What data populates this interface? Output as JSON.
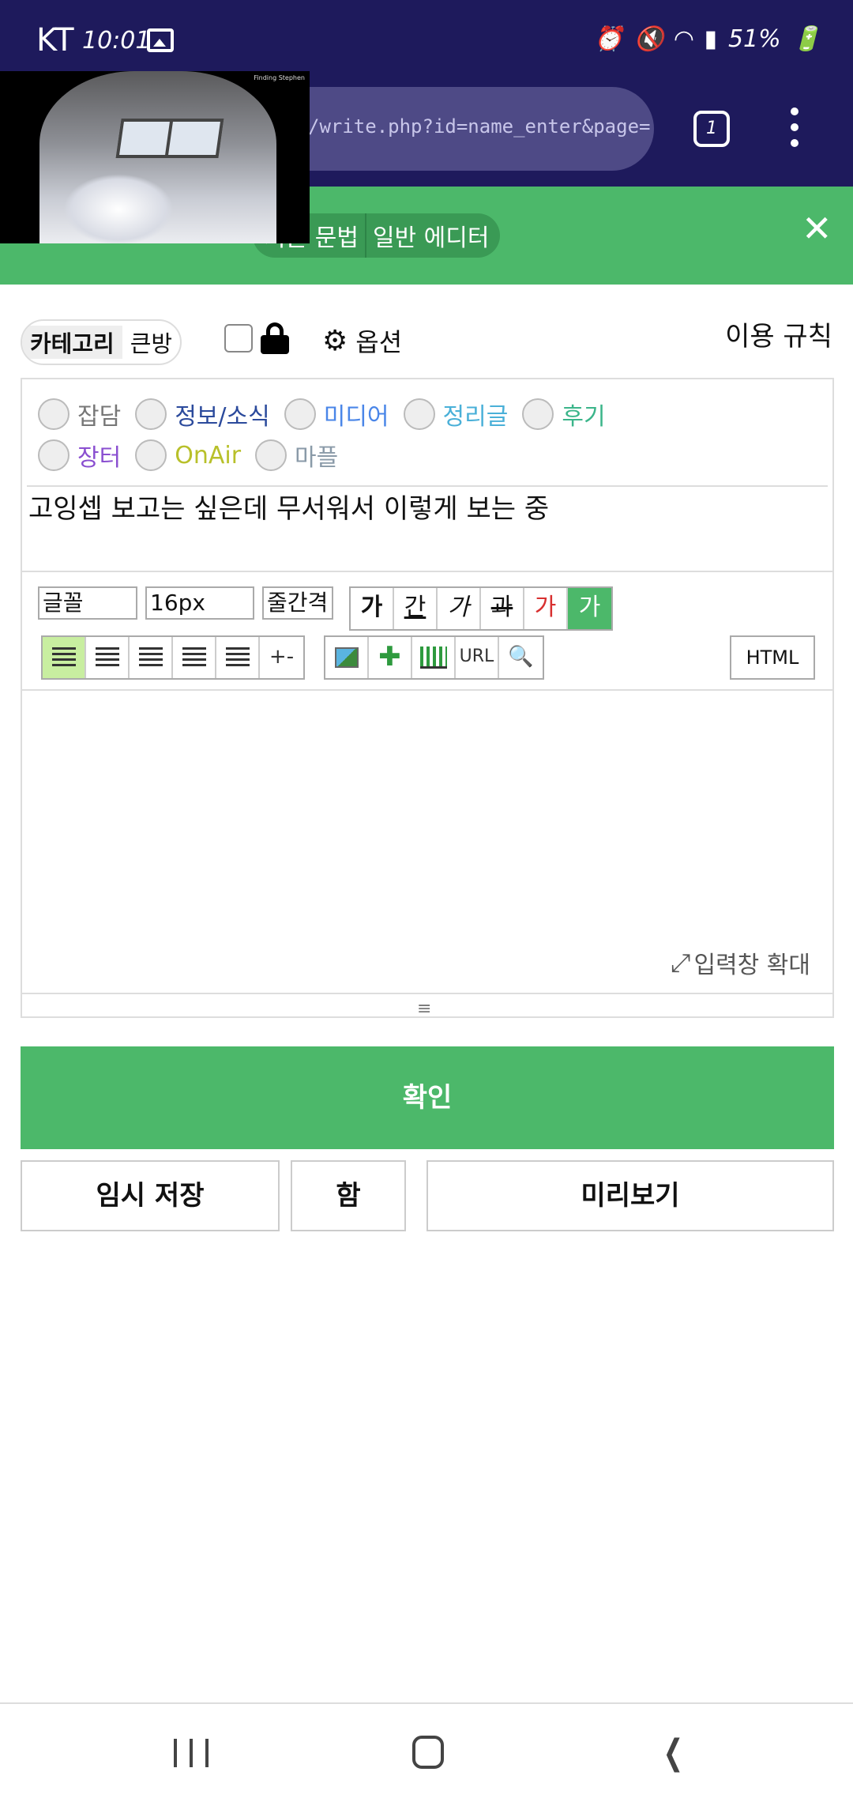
{
  "status_bar": {
    "carrier": "KT",
    "time": "10:01",
    "battery": "51%"
  },
  "browser": {
    "url": "/write.php?id=name_enter&page=",
    "tab_count": "1"
  },
  "editor_header": {
    "mode_left": "기본 문법",
    "mode_right": "일반 에디터"
  },
  "toolbar_top": {
    "category_label": "카테고리",
    "bigroom_label": "큰방",
    "options_label": "옵션",
    "rules_label": "이용 규칙"
  },
  "categories": [
    {
      "label": "잡담",
      "color": "#777777"
    },
    {
      "label": "정보/소식",
      "color": "#2b4a9c"
    },
    {
      "label": "미디어",
      "color": "#4a86e8"
    },
    {
      "label": "정리글",
      "color": "#4ab0d8"
    },
    {
      "label": "후기",
      "color": "#3bb58a"
    },
    {
      "label": "장터",
      "color": "#8a4fd0"
    },
    {
      "label": "OnAir",
      "color": "#b8c02a"
    },
    {
      "label": "마플",
      "color": "#8a9aa8"
    }
  ],
  "subject": "고잉셉 보고는 싶은데 무서워서 이렇게 보는 중",
  "editor_toolbar": {
    "font_placeholder": "글꼴",
    "font_size": "16px",
    "line_spacing": "줄간격",
    "format_buttons": [
      "가",
      "간",
      "가",
      "과",
      "가",
      "가"
    ],
    "url_label": "URL",
    "plusminus_label": "+-",
    "html_label": "HTML"
  },
  "expand_label": "입력창 확대",
  "actions": {
    "confirm": "확인",
    "temp_save": "임시 저장",
    "box": "함",
    "preview": "미리보기"
  },
  "video": {
    "caption": "Finding Stephen"
  }
}
